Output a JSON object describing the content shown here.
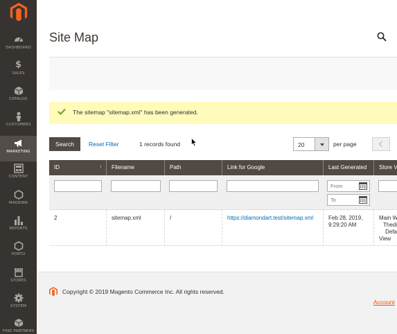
{
  "sidebar": {
    "items": [
      {
        "label": "DASHBOARD",
        "icon": "dashboard-icon"
      },
      {
        "label": "SALES",
        "icon": "dollar-icon"
      },
      {
        "label": "CATALOG",
        "icon": "cube-icon"
      },
      {
        "label": "CUSTOMERS",
        "icon": "person-icon"
      },
      {
        "label": "MARKETING",
        "icon": "megaphone-icon",
        "active": true
      },
      {
        "label": "CONTENT",
        "icon": "content-icon"
      },
      {
        "label": "MAGEINN",
        "icon": "hexagon-icon"
      },
      {
        "label": "REPORTS",
        "icon": "bar-chart-icon"
      },
      {
        "label": "PORTO",
        "icon": "hexagon-icon"
      },
      {
        "label": "STORES",
        "icon": "store-icon"
      },
      {
        "label": "SYSTEM",
        "icon": "gear-icon"
      },
      {
        "label": "FIND PARTNERS",
        "icon": "partners-icon"
      }
    ]
  },
  "header": {
    "title": "Site Map"
  },
  "message": {
    "text": "The sitemap \"sitemap.xml\" has been generated."
  },
  "toolbar": {
    "search_label": "Search",
    "reset_label": "Reset Filter",
    "records_found": "1 records found",
    "per_page_value": "20",
    "per_page_label": "per page"
  },
  "grid": {
    "columns": [
      "ID",
      "Filename",
      "Path",
      "Link for Google",
      "Last Generated",
      "Store V"
    ],
    "filters": {
      "from_placeholder": "From",
      "to_placeholder": "To"
    },
    "rows": [
      {
        "id": "2",
        "filename": "sitemap.xml",
        "path": "/",
        "link": "https://diamondart.test/sitemap.xml",
        "last_generated_line1": "Feb 28, 2019,",
        "last_generated_line2": "9:29:20 AM",
        "store_view_line1": "Main W",
        "store_view_line2": "Thedi",
        "store_view_line3": "Defa",
        "store_view_line4": "View"
      }
    ]
  },
  "footer": {
    "copyright": "Copyright © 2019 Magento Commerce Inc. All rights reserved.",
    "account_link": "Account"
  },
  "colors": {
    "sidebar_bg": "#373330",
    "accent": "#eb5202",
    "grid_header": "#514943",
    "link": "#006bb4",
    "message_bg": "#fffbbb",
    "success": "#79a22e"
  }
}
